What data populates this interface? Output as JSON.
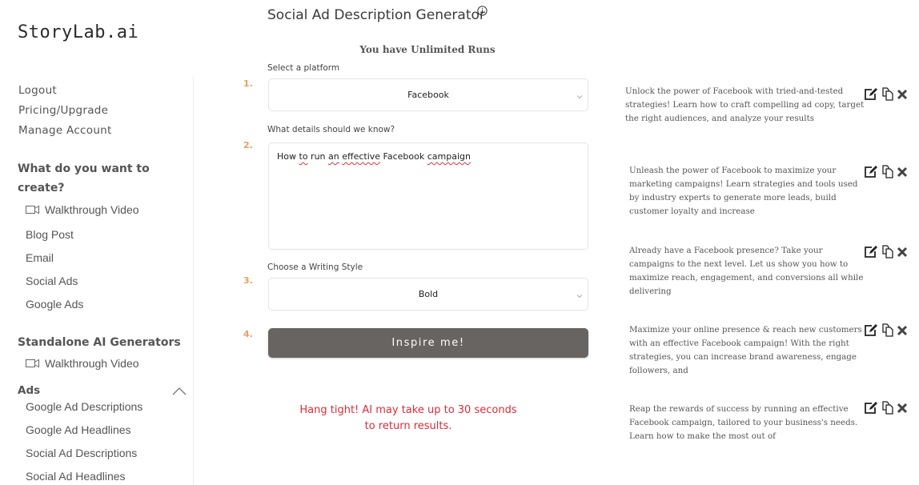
{
  "brand": {
    "logo": "StoryLab.ai"
  },
  "account_links": [
    {
      "label": "Logout"
    },
    {
      "label": "Pricing/Upgrade"
    },
    {
      "label": "Manage Account"
    }
  ],
  "sidebar": {
    "create_section": {
      "heading_line1": "What do you want to",
      "heading_line2": "create?",
      "items": [
        {
          "label": "Walkthrough Video",
          "icon": "video-icon"
        },
        {
          "label": "Blog Post"
        },
        {
          "label": "Email"
        },
        {
          "label": "Social Ads"
        },
        {
          "label": "Google Ads"
        }
      ]
    },
    "standalone_section": {
      "heading": "Standalone AI Generators",
      "items": [
        {
          "label": "Walkthrough Video",
          "icon": "video-icon"
        }
      ]
    },
    "ads_group": {
      "heading": "Ads",
      "expanded": true,
      "items": [
        {
          "label": "Google Ad Descriptions"
        },
        {
          "label": "Google Ad Headlines"
        },
        {
          "label": "Social Ad Descriptions"
        },
        {
          "label": "Social Ad Headlines"
        }
      ]
    }
  },
  "main": {
    "title": "Social Ad Description Generator",
    "runs_text": "You have Unlimited Runs",
    "steps": [
      "1.",
      "2.",
      "3.",
      "4."
    ],
    "platform": {
      "label": "Select a platform",
      "value": "Facebook"
    },
    "details": {
      "label": "What details should we know?",
      "value_parts": [
        "How ",
        "to",
        " run ",
        "an",
        " ",
        "effective",
        " Facebook ",
        "campaign"
      ]
    },
    "style": {
      "label": "Choose a Writing Style",
      "value": "Bold"
    },
    "submit_label": "Inspire me!",
    "wait_line1": "Hang tight! AI may take up to 30 seconds",
    "wait_line2": "to return results."
  },
  "results": [
    {
      "text": "Unlock the power of Facebook with tried-and-tested strategies! Learn how to craft compelling ad copy, target the right audiences, and analyze your results"
    },
    {
      "text": "Unleash the power of Facebook to maximize your marketing campaigns! Learn strategies and tools used by industry experts to generate more leads, build customer loyalty and increase"
    },
    {
      "text": "Already have a Facebook presence? Take your campaigns to the next level. Let us show you how to maximize reach, engagement, and conversions all while delivering"
    },
    {
      "text": "Maximize your online presence & reach new customers with an effective Facebook campaign! With the right strategies, you can increase brand awareness, engage followers, and"
    },
    {
      "text": "Reap the rewards of success by running an effective Facebook campaign, tailored to your business's needs. Learn how to make the most out of"
    }
  ],
  "colors": {
    "step_number": "#e6a060",
    "button_bg": "#676462",
    "warning_text": "#dc2b3a"
  }
}
